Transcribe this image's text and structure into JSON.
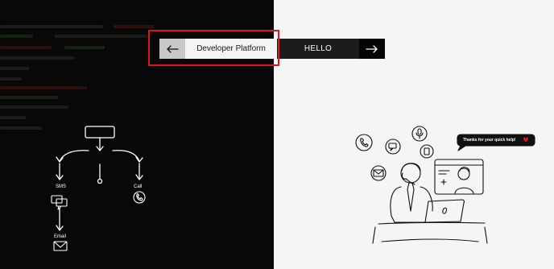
{
  "colors": {
    "left_background": "#080808",
    "right_background": "#f5f5f5",
    "highlight_border": "#e0141e",
    "heart": "#e0141e"
  },
  "nav": {
    "back_icon": "arrow-left-icon",
    "crumb_label": "Developer Platform",
    "next_label": "HELLO",
    "next_icon": "arrow-right-icon"
  },
  "flow": {
    "sms_label": "SMS",
    "call_label": "Call",
    "email_label": "Email"
  },
  "illustration": {
    "speech_bubble": "Thanks for your quick help!"
  }
}
